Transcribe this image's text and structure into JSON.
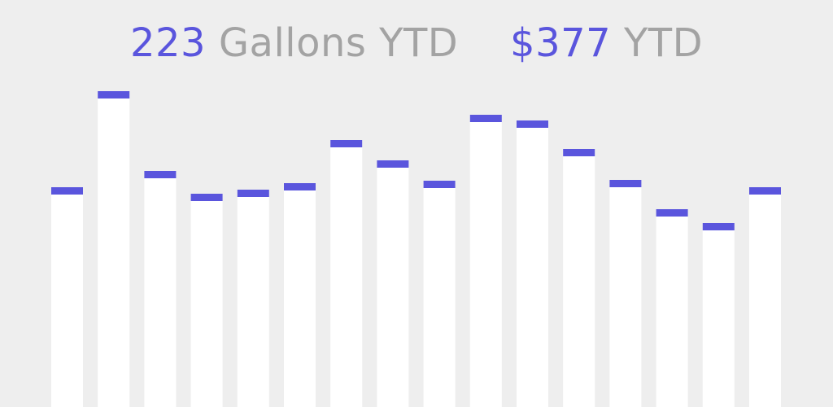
{
  "summary": {
    "gallons_value": "223",
    "gallons_unit": "Gallons YTD",
    "cost_value": "$377",
    "cost_unit": "YTD"
  },
  "colors": {
    "background": "#eeeeee",
    "bar": "#ffffff",
    "bar_cap": "#5a55dd",
    "value_text": "#5a55dd",
    "label_text": "#a3a3a3"
  },
  "chart_data": {
    "type": "bar",
    "categories": [],
    "values": [
      270,
      388,
      290,
      262,
      267,
      275,
      328,
      303,
      278,
      359,
      352,
      317,
      279,
      243,
      226,
      270
    ],
    "title": "",
    "xlabel": "",
    "ylabel": "",
    "ylim": [
      0,
      500
    ],
    "grid": false,
    "legend": "none"
  }
}
